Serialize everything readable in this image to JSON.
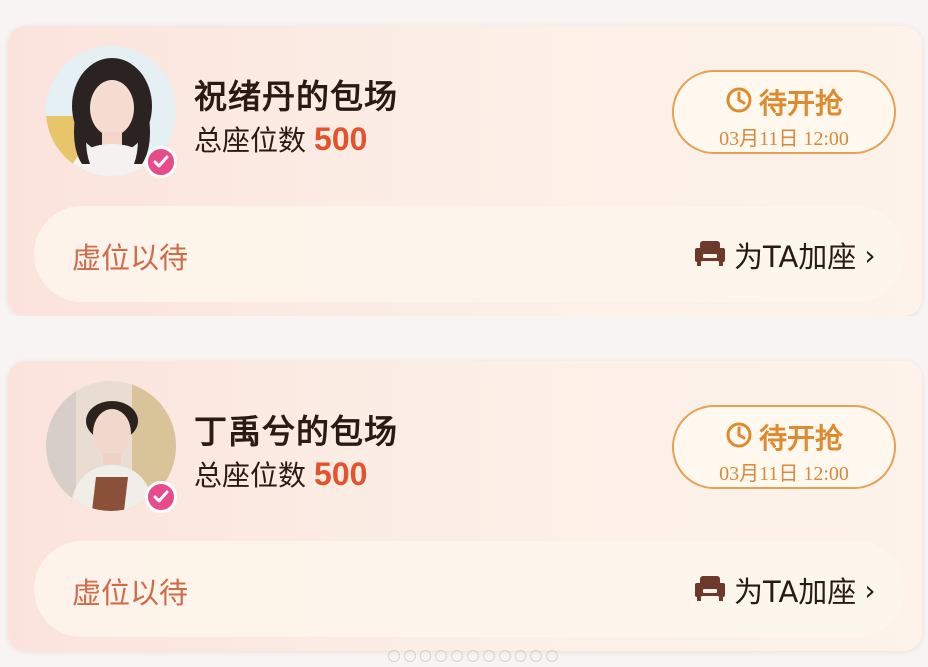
{
  "colors": {
    "accent_orange": "#de8a2e",
    "seat_count_red": "#e2532e",
    "vacant_text": "#cf6a4a",
    "verify_badge": "#e84b8a"
  },
  "cards": [
    {
      "title": "祝绪丹的包场",
      "seats_label": "总座位数",
      "seats_value": "500",
      "grab_label": "待开抢",
      "grab_time": "03月11日 12:00",
      "vacant_label": "虚位以待",
      "add_seat_label": "为TA加座",
      "avatar_icon": "female-avatar",
      "badge_icon": "verified-check-icon"
    },
    {
      "title": "丁禹兮的包场",
      "seats_label": "总座位数",
      "seats_value": "500",
      "grab_label": "待开抢",
      "grab_time": "03月11日 12:00",
      "vacant_label": "虚位以待",
      "add_seat_label": "为TA加座",
      "avatar_icon": "male-avatar",
      "badge_icon": "verified-check-icon"
    }
  ]
}
